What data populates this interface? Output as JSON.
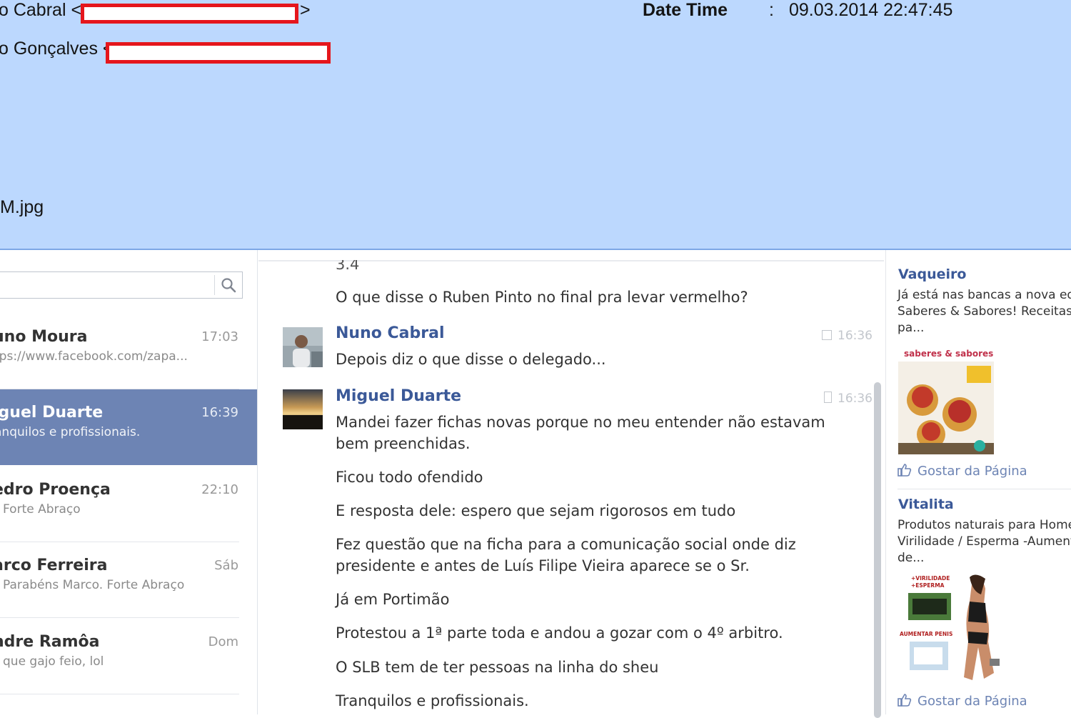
{
  "email": {
    "from_name": "o Cabral <",
    "from_end": ">",
    "to_name": "o Gonçalves <",
    "datetime_label": "Date Time",
    "datetime_colon": ":",
    "datetime_value": "09.03.2014 22:47:45",
    "attachment": "M.jpg"
  },
  "search": {
    "placeholder": "",
    "icon": "search-icon"
  },
  "conversations": [
    {
      "name": "uno Moura",
      "time": "17:03",
      "snippet": "tps://www.facebook.com/zapa..."
    },
    {
      "name": "iguel Duarte",
      "time": "16:39",
      "snippet": "anquilos e profissionais."
    },
    {
      "name": "edro Proença",
      "time": "22:10",
      "snippet": "Forte Abraço"
    },
    {
      "name": "arco Ferreira",
      "time": "Sáb",
      "snippet": "Parabéns Marco. Forte Abraço"
    },
    {
      "name": "ndre Ramôa",
      "time": "Dom",
      "snippet": "que gajo feio, lol"
    }
  ],
  "thread": {
    "partial_top": "3.4",
    "first_msg": "O que disse o Ruben Pinto no final pra levar vermelho?",
    "blocks": [
      {
        "sender": "Nuno Cabral",
        "time": "16:36",
        "lines": [
          "Depois diz o que disse o delegado..."
        ]
      },
      {
        "sender": "Miguel Duarte",
        "time": "16:36",
        "lines": [
          "Mandei fazer fichas novas porque no meu entender não estavam",
          "bem preenchidas."
        ]
      }
    ],
    "messages": [
      "Ficou todo ofendido",
      "E resposta dele: espero que sejam rigorosos em tudo",
      "Fez questão que na ficha para a comunicação social onde diz",
      "presidente e antes de Luís Filipe Vieira aparece se o Sr.",
      "Já em Portimão",
      "Protestou a 1ª parte toda e andou a gozar com o 4º arbitro.",
      "O SLB tem de ter pessoas na linha do sheu",
      "Tranquilos e profissionais."
    ]
  },
  "ads": [
    {
      "title": "Vaqueiro",
      "body": [
        "Já está nas bancas a nova ed",
        "Saberes & Sabores! Receitas",
        "pa..."
      ],
      "image_text": "saberes & sabores",
      "like": "Gostar da Página"
    },
    {
      "title": "Vitalita",
      "body": [
        "Produtos naturais para Home",
        "Virilidade / Esperma -Aumenta",
        "de..."
      ],
      "image_text": [
        "+VIRILIDADE",
        "+ESPERMA",
        "AUMENTAR PENIS"
      ],
      "like": "Gostar da Página"
    }
  ],
  "colors": {
    "header_bg": "#bcd8fe",
    "fb_blue": "#3b5998",
    "active_row": "#6d84b4",
    "redaction": "#e5161c"
  }
}
